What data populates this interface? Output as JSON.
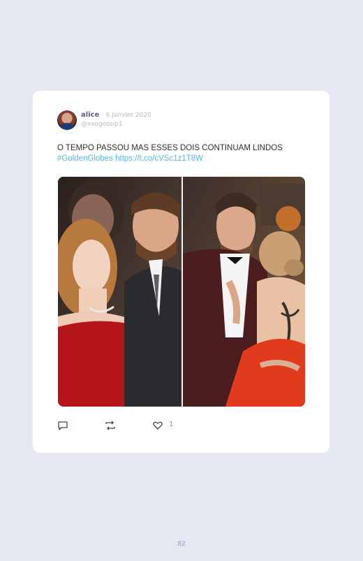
{
  "tweet": {
    "author": "alice",
    "separator": "·",
    "date": "6 janvier 2020",
    "handle": "@xxogossip1",
    "text_main": "O TEMPO PASSOU MAS ESSES DOIS CONTINUAM LINDOS ",
    "hashtag": "#GoldenGlobes",
    "link": "https://t.co/cVSc1z1T8W",
    "likes": "1"
  },
  "icons": {
    "avatar": "user-avatar",
    "reply": "reply-icon",
    "retweet": "retweet-icon",
    "like": "heart-icon"
  },
  "page": {
    "number": "82"
  },
  "colors": {
    "background": "#e5e7f3",
    "card": "#ffffff",
    "link": "#5bb6e6",
    "author": "#59607b",
    "muted": "#b8bdcc"
  }
}
